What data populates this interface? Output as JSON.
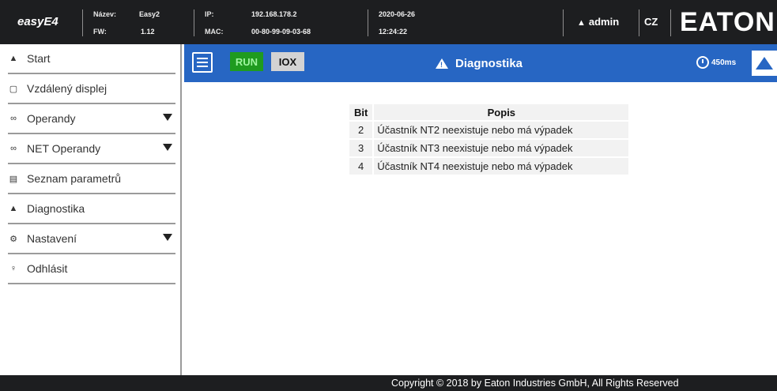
{
  "header": {
    "brand": "easyE4",
    "name_label": "Název:",
    "name_value": "Easy2",
    "fw_label": "FW:",
    "fw_value": "1.12",
    "ip_label": "IP:",
    "ip_value": "192.168.178.2",
    "mac_label": "MAC:",
    "mac_value": "00-80-99-09-03-68",
    "date": "2020-06-26",
    "time": "12:24:22",
    "user": "admin",
    "language": "CZ",
    "logo": "EATON"
  },
  "sidebar": {
    "items": [
      {
        "label": "Start",
        "icon": "home-icon",
        "glyph": "▲",
        "expandable": false
      },
      {
        "label": "Vzdálený displej",
        "icon": "monitor-icon",
        "glyph": "▢",
        "expandable": false
      },
      {
        "label": "Operandy",
        "icon": "link-icon",
        "glyph": "∞",
        "expandable": true
      },
      {
        "label": "NET Operandy",
        "icon": "link-icon",
        "glyph": "∞",
        "expandable": true
      },
      {
        "label": "Seznam parametrů",
        "icon": "list-icon",
        "glyph": "▤",
        "expandable": false
      },
      {
        "label": "Diagnostika",
        "icon": "warning-icon",
        "glyph": "▲",
        "expandable": false
      },
      {
        "label": "Nastavení",
        "icon": "gear-icon",
        "glyph": "⚙",
        "expandable": true
      },
      {
        "label": "Odhlásit",
        "icon": "user-icon",
        "glyph": "♀",
        "expandable": false
      }
    ]
  },
  "toolbar": {
    "run_label": "RUN",
    "iox_label": "IOX",
    "title": "Diagnostika",
    "cycle_time": "450ms",
    "run_color": "#1f9b1f",
    "bar_color": "#2766c3"
  },
  "diagnostics": {
    "columns": [
      "Bit",
      "Popis"
    ],
    "rows": [
      {
        "bit": "2",
        "popis": "Účastník NT2 neexistuje nebo má výpadek"
      },
      {
        "bit": "3",
        "popis": "Účastník NT3 neexistuje nebo má výpadek"
      },
      {
        "bit": "4",
        "popis": "Účastník NT4 neexistuje nebo má výpadek"
      }
    ]
  },
  "footer": {
    "copyright": "Copyright © 2018 by Eaton Industries GmbH, All Rights Reserved"
  }
}
